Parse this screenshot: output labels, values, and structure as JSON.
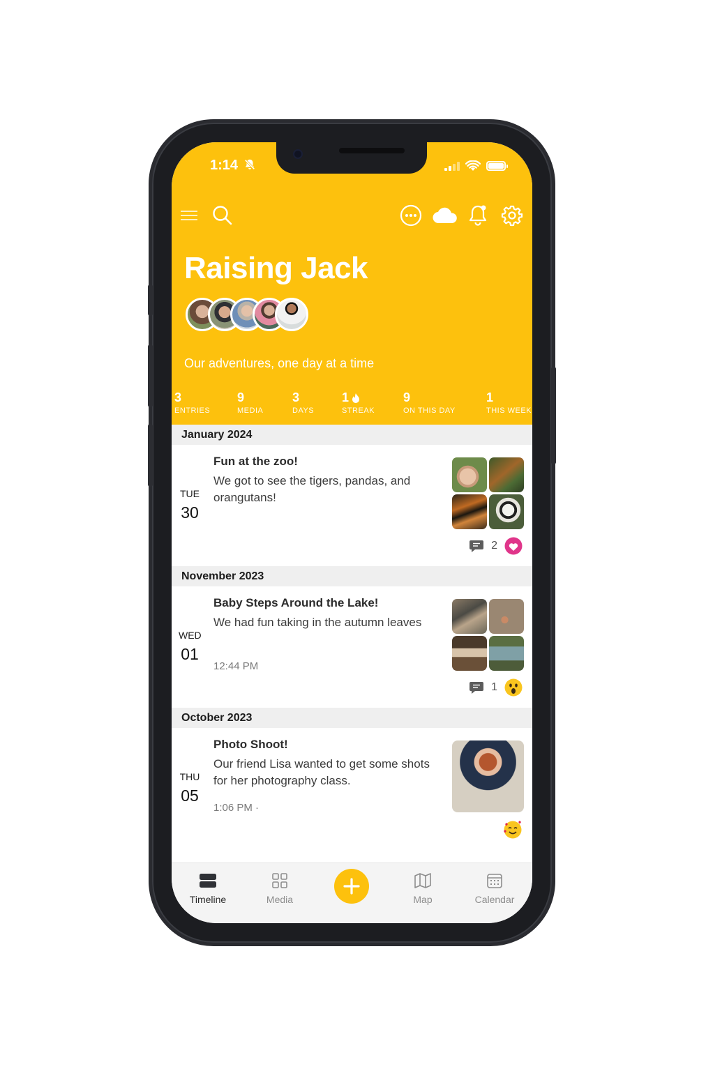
{
  "status": {
    "time": "1:14"
  },
  "journal": {
    "title": "Raising Jack",
    "subtitle": "Our adventures, one day at a time"
  },
  "stats": [
    {
      "value": "3",
      "label": "ENTRIES"
    },
    {
      "value": "9",
      "label": "MEDIA"
    },
    {
      "value": "3",
      "label": "DAYS"
    },
    {
      "value": "1",
      "label": "STREAK"
    },
    {
      "value": "9",
      "label": "ON THIS DAY"
    },
    {
      "value": "1",
      "label": "THIS WEEK"
    }
  ],
  "sections": [
    {
      "month": "January 2024",
      "entry": {
        "dow": "TUE",
        "day": "30",
        "title": "Fun at the zoo!",
        "body": "We got to see the tigers, pandas, and orangutans!",
        "time": "",
        "comments": "2"
      }
    },
    {
      "month": "November 2023",
      "entry": {
        "dow": "WED",
        "day": "01",
        "title": "Baby Steps Around the Lake!",
        "body": "We had fun taking in the autumn leaves",
        "time": "12:44 PM",
        "comments": "1"
      }
    },
    {
      "month": "October 2023",
      "entry": {
        "dow": "THU",
        "day": "05",
        "title": "Photo Shoot!",
        "body": "Our friend Lisa wanted to get some shots for her photography class.",
        "time": "1:06 PM ·",
        "comments": ""
      }
    }
  ],
  "tabs": [
    {
      "label": "Timeline",
      "icon": "timeline-icon"
    },
    {
      "label": "Media",
      "icon": "grid-icon"
    },
    {
      "label": "Map",
      "icon": "map-icon"
    },
    {
      "label": "Calendar",
      "icon": "calendar-icon"
    }
  ],
  "colors": {
    "accent": "#fdc10d",
    "heart": "#e0358a"
  }
}
